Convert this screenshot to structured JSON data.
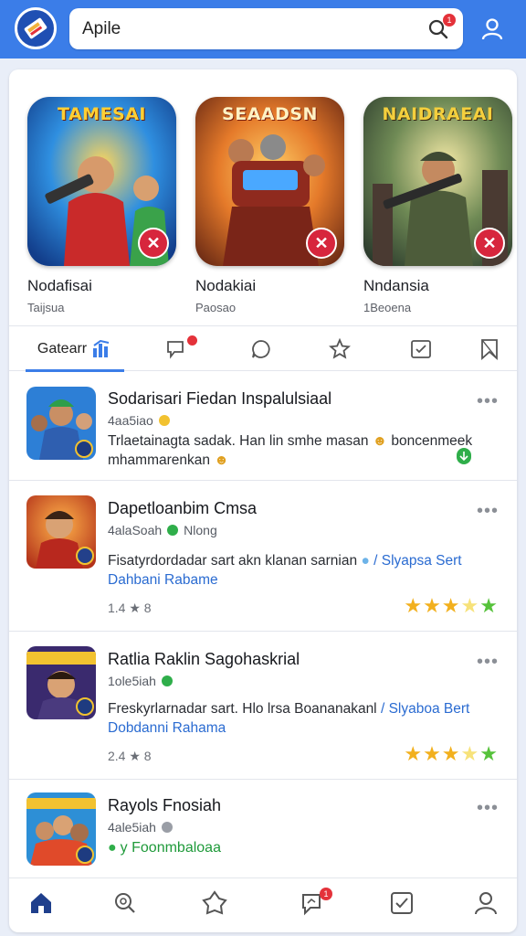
{
  "colors": {
    "brand": "#3b7de8",
    "badge_red": "#e4323a",
    "link": "#2a6bd1",
    "star_yellow": "#f2b01e",
    "star_green": "#56c23b"
  },
  "header": {
    "search_value": "Apile",
    "search_badge": "1",
    "icons": [
      "app-logo-icon",
      "search-icon",
      "profile-icon"
    ]
  },
  "featured": [
    {
      "art_title": "TAMESAI",
      "name": "Nodafisai",
      "sub": "Taijsua"
    },
    {
      "art_title": "SEAADSN",
      "name": "Nodakiai",
      "sub": "Paosao"
    },
    {
      "art_title": "NAIDRAEAI",
      "name": "Nndansia",
      "sub": "1Beoena"
    }
  ],
  "tabs": {
    "active_label": "Gatearr",
    "icons": [
      "games-tab-icon",
      "comments-tab-icon",
      "chat-tab-icon",
      "star-tab-icon",
      "checklist-tab-icon",
      "bookmark-tab-icon"
    ]
  },
  "feed": [
    {
      "title": "Sodarisari Fiedan Inspalulsiaal",
      "meta": "4aa5iao",
      "desc": "Trlaetainagta sadak. Han lin smhe masan",
      "desc2": "boncenmeek mhammarenkan",
      "more": "•••"
    },
    {
      "title": "Dapetloanbim Cmsa",
      "meta": "4alaSoah",
      "meta2": "Nlong",
      "desc": "Fisatyrdordadar sart akn klanan sarnian",
      "link": "/ Slyapsa Sert Dahbani Rabame",
      "stats": "1.4 ★ 8",
      "stars": [
        "y",
        "y",
        "y",
        "l",
        "g"
      ],
      "more": "•••"
    },
    {
      "title": "Ratlia Raklin Sagohaskrial",
      "meta": "1ole5iah",
      "desc": "Freskyrlarnadar sart. Hlo lrsa Boananakanl",
      "link": "/ Slyaboa Bert Dobdanni Rahama",
      "stats": "2.4 ★ 8",
      "stars": [
        "y",
        "y",
        "y",
        "l",
        "g"
      ],
      "more": "•••"
    },
    {
      "title": "Rayols Fnosiah",
      "meta": "4ale5iah",
      "tag": "y Foonmbaloaa",
      "more": "•••"
    }
  ],
  "bottom_nav": {
    "icons": [
      "home-icon",
      "search-nav-icon",
      "explore-icon",
      "notifications-icon",
      "tasks-icon",
      "profile-nav-icon"
    ],
    "badge": "1"
  }
}
